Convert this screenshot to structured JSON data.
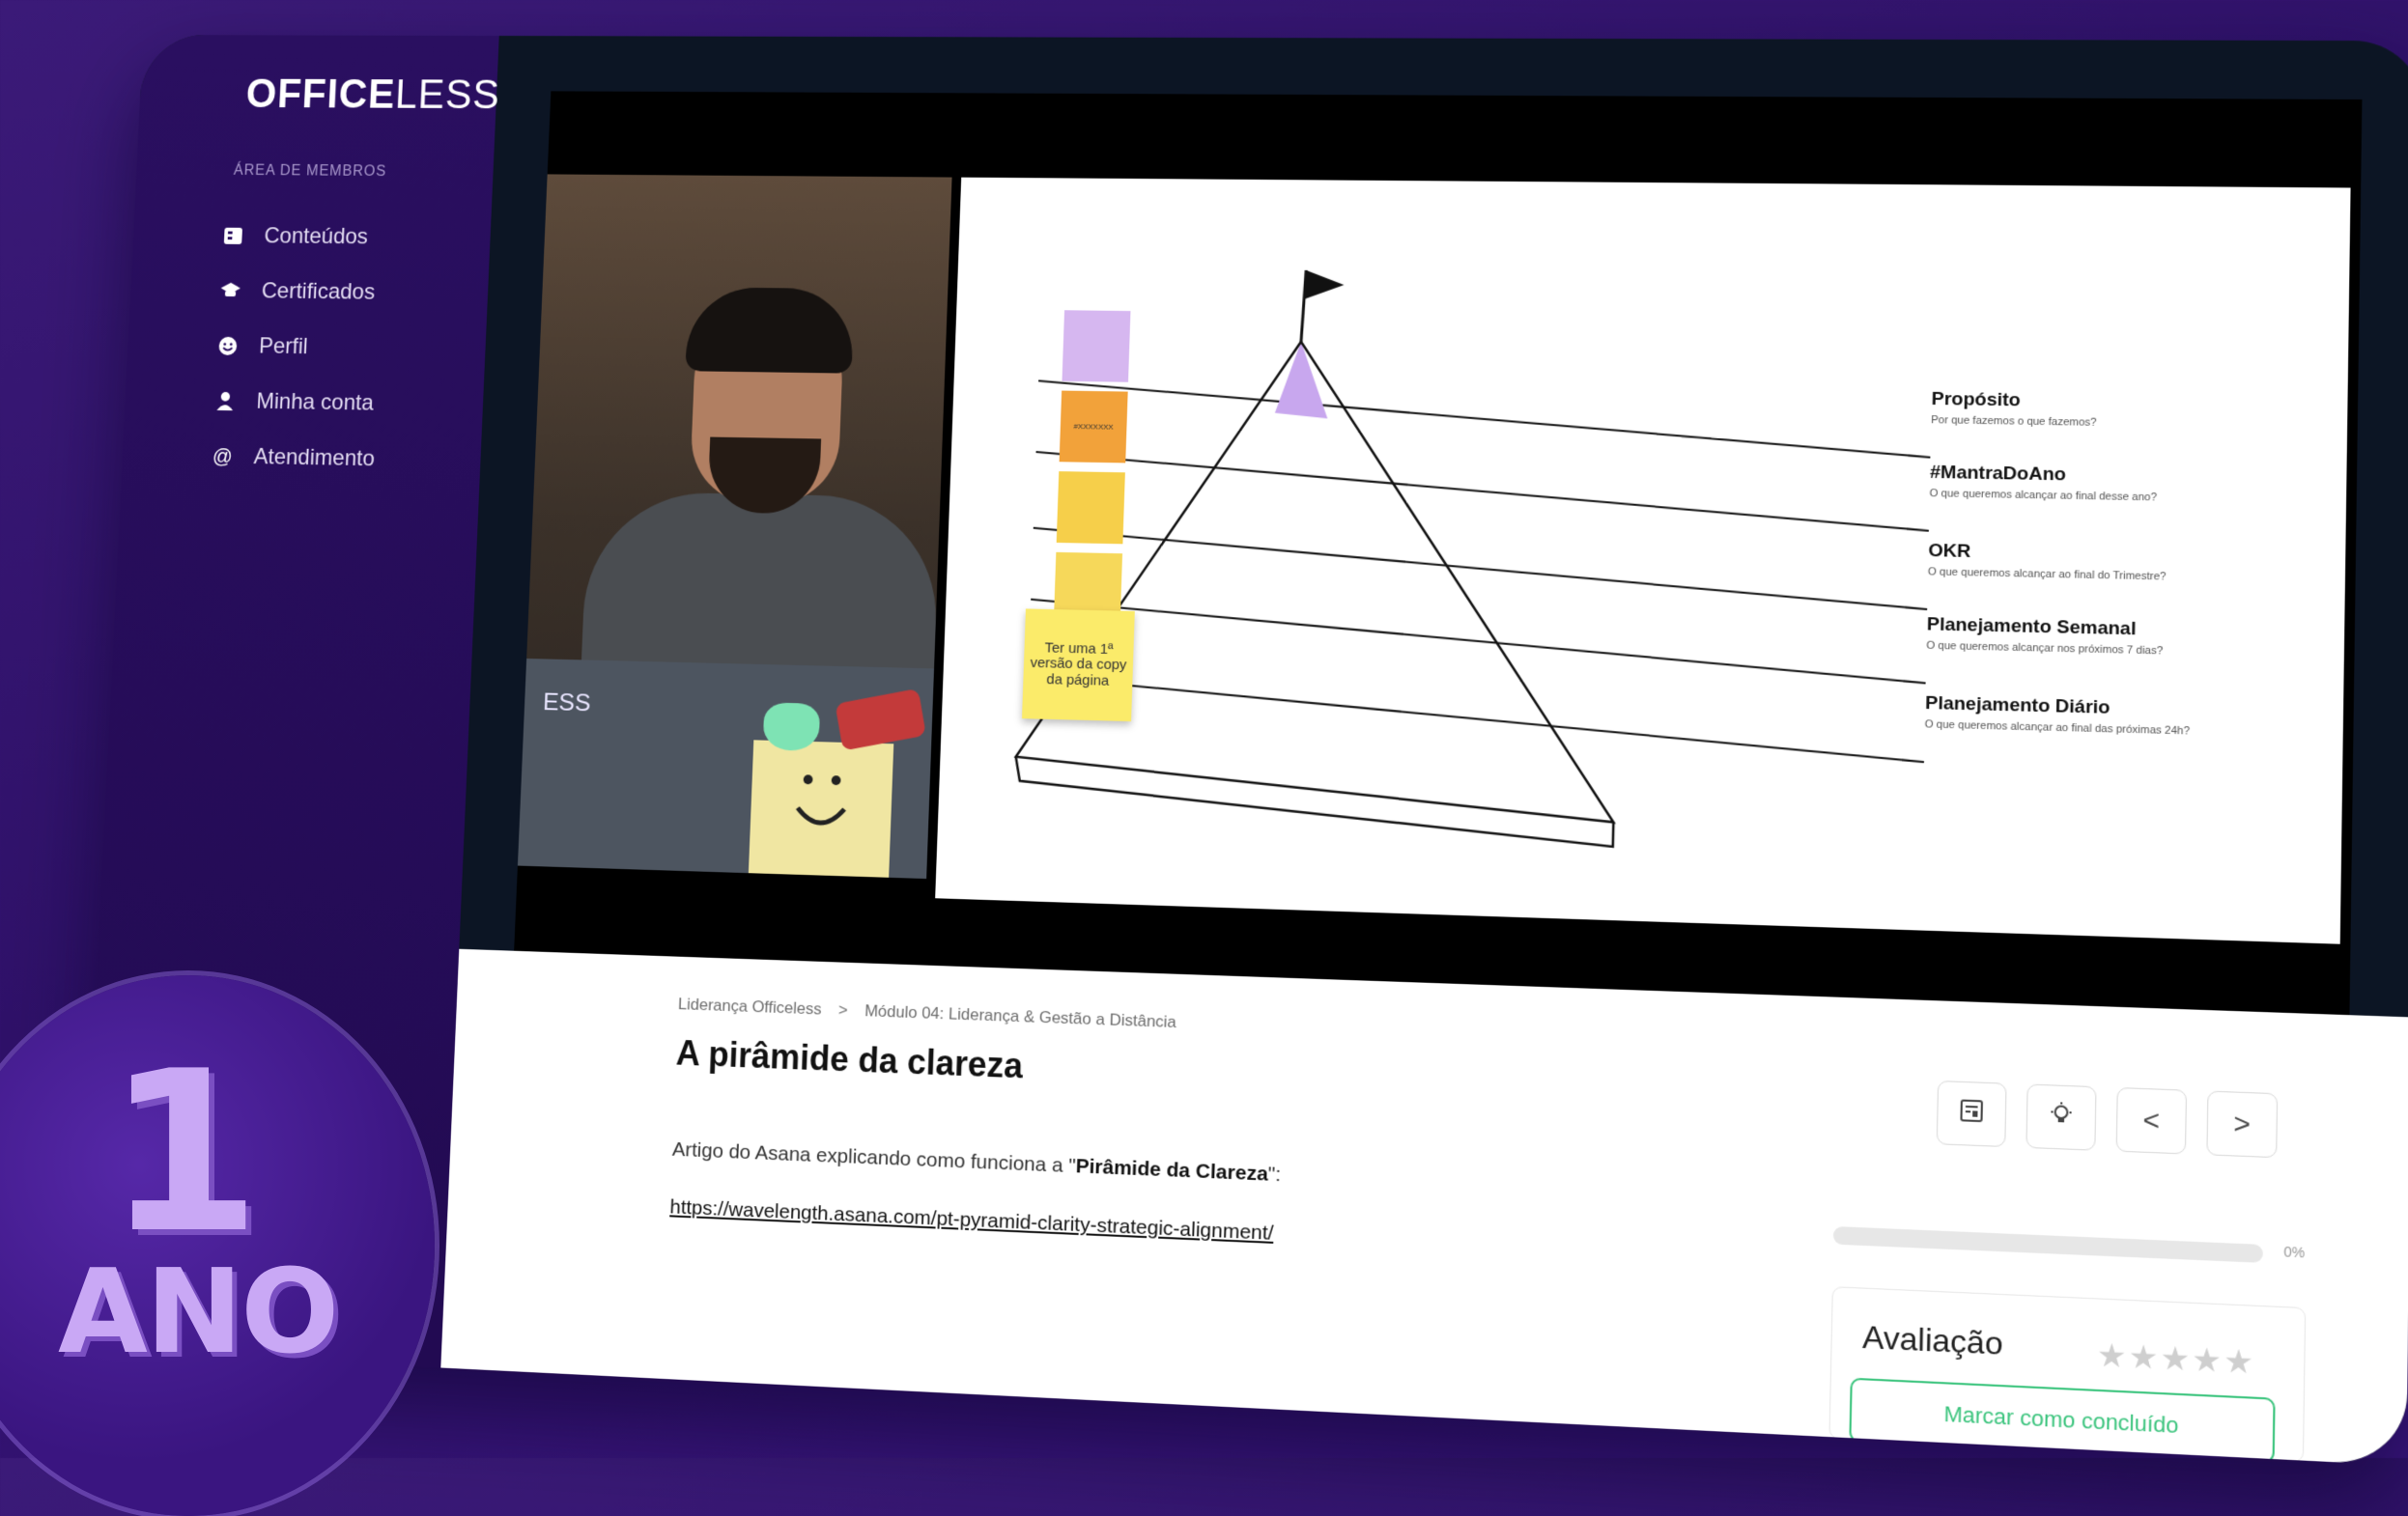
{
  "app": {
    "logo_bold": "OFFICE",
    "logo_light": "LESS",
    "area_label": "ÁREA DE MEMBROS"
  },
  "sidebar": {
    "items": [
      {
        "label": "Conteúdos",
        "icon": "book-icon"
      },
      {
        "label": "Certificados",
        "icon": "graduation-cap-icon"
      },
      {
        "label": "Perfil",
        "icon": "smile-icon"
      },
      {
        "label": "Minha conta",
        "icon": "user-icon"
      },
      {
        "label": "Atendimento",
        "icon": "at-icon"
      }
    ]
  },
  "video": {
    "cam_logo": "ESS",
    "slide": {
      "rows": [
        {
          "title": "Propósito",
          "sub": "Por que fazemos o que fazemos?"
        },
        {
          "title": "#MantraDoAno",
          "sub": "O que queremos alcançar ao final desse ano?"
        },
        {
          "title": "OKR",
          "sub": "O que queremos alcançar ao final do Trimestre?"
        },
        {
          "title": "Planejamento Semanal",
          "sub": "O que queremos alcançar nos próximos 7 dias?"
        },
        {
          "title": "Planejamento Diário",
          "sub": "O que queremos alcançar ao final das próximas 24h?"
        }
      ],
      "postits": [
        {
          "text": "",
          "color": "#d6b7f0"
        },
        {
          "text": "#XXXXXXX",
          "color": "#f2a23a"
        },
        {
          "text": "",
          "color": "#f6cf4a"
        },
        {
          "text": "",
          "color": "#f6d85a"
        }
      ],
      "big_postit": "Ter uma 1ª versão da copy da página"
    }
  },
  "content": {
    "breadcrumb": [
      "Liderança Officeless",
      "Módulo 04: Liderança & Gestão a Distância"
    ],
    "breadcrumb_sep": ">",
    "title": "A pirâmide da clareza",
    "description_prefix": "Artigo do Asana explicando como funciona a \"",
    "description_bold": "Pirâmide da Clareza",
    "description_suffix": "\":",
    "link": "https://wavelength.asana.com/pt-pyramid-clarity-strategic-alignment/",
    "progress_percent": 0,
    "progress_label": "0%",
    "rating_label": "Avaliação",
    "rating_value": 0,
    "rating_max": 5,
    "complete_button": "Marcar como concluído",
    "toolbar": {
      "prev": "<",
      "next": ">"
    }
  },
  "badge": {
    "number": "1",
    "word": "ANO"
  },
  "colors": {
    "accent": "#3bc47d",
    "brand": "#3a1580"
  }
}
